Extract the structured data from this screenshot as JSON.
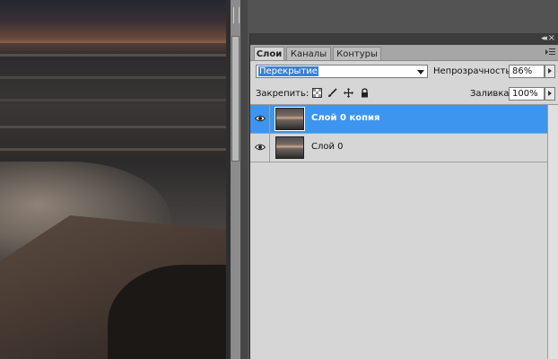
{
  "panel": {
    "tabs": [
      {
        "label": "Слои",
        "active": true
      },
      {
        "label": "Каналы",
        "active": false
      },
      {
        "label": "Контуры",
        "active": false
      }
    ],
    "blend_mode": "Перекрытие",
    "opacity_label": "Непрозрачность:",
    "opacity_value": "86%",
    "lock_label": "Закрепить:",
    "fill_label": "Заливка:",
    "fill_value": "100%",
    "layers": [
      {
        "name": "Слой 0 копия",
        "selected": true,
        "visible": true
      },
      {
        "name": "Слой 0",
        "selected": false,
        "visible": true
      }
    ]
  },
  "colors": {
    "selection": "#3d95f0",
    "panel_bg": "#d6d6d6",
    "workspace_bg": "#535353"
  },
  "icons": [
    "eye-icon",
    "lock-transparent-icon",
    "lock-brush-icon",
    "lock-move-icon",
    "lock-all-icon",
    "panel-menu-icon",
    "collapse-icon",
    "close-icon",
    "dropdown-arrow-icon",
    "stepper-arrow-icon"
  ]
}
